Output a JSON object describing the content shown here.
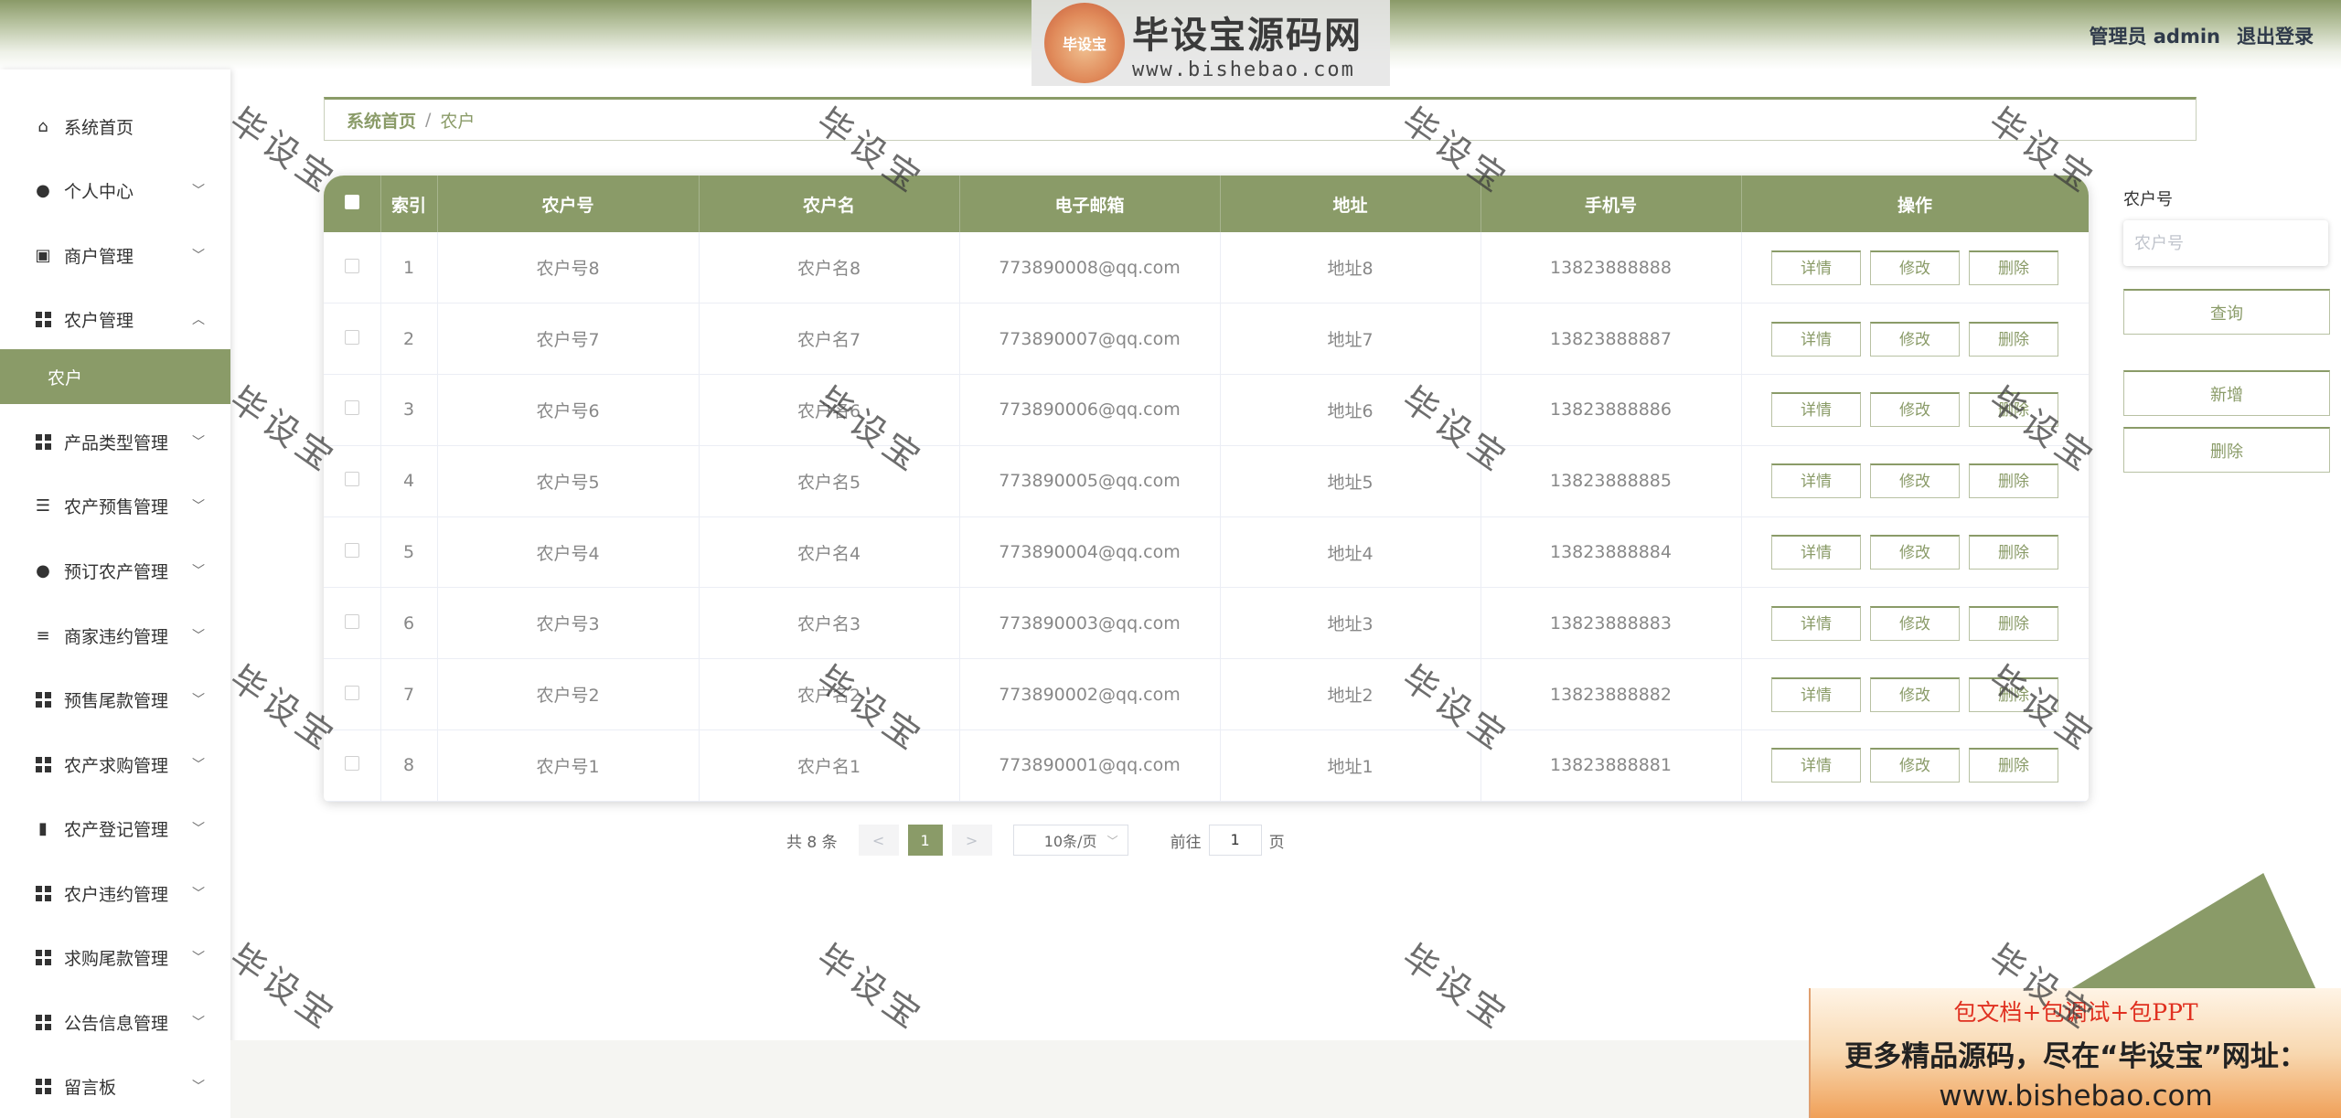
{
  "header": {
    "user_label": "管理员 admin",
    "logout_label": "退出登录"
  },
  "logo": {
    "badge": "毕设宝",
    "title": "毕设宝源码网",
    "url": "www.bishebao.com"
  },
  "sidebar": {
    "items": [
      {
        "label": "系统首页",
        "icon": "home-icon"
      },
      {
        "label": "个人中心",
        "icon": "user-icon"
      },
      {
        "label": "商户管理",
        "icon": "clipboard-check-icon"
      },
      {
        "label": "农户管理",
        "icon": "grid-icon"
      },
      {
        "label": "农户",
        "icon": ""
      },
      {
        "label": "产品类型管理",
        "icon": "grid-icon"
      },
      {
        "label": "农产预售管理",
        "icon": "sliders-icon"
      },
      {
        "label": "预订农产管理",
        "icon": "leaf-icon"
      },
      {
        "label": "商家违约管理",
        "icon": "list-icon"
      },
      {
        "label": "预售尾款管理",
        "icon": "grid-icon"
      },
      {
        "label": "农产求购管理",
        "icon": "grid-icon"
      },
      {
        "label": "农产登记管理",
        "icon": "bar-chart-icon"
      },
      {
        "label": "农户违约管理",
        "icon": "grid-icon"
      },
      {
        "label": "求购尾款管理",
        "icon": "grid-icon"
      },
      {
        "label": "公告信息管理",
        "icon": "grid-icon"
      },
      {
        "label": "留言板",
        "icon": "grid-icon"
      }
    ]
  },
  "breadcrumb": {
    "home": "系统首页",
    "separator": "/",
    "current": "农户"
  },
  "table": {
    "headers": [
      "索引",
      "农户号",
      "农户名",
      "电子邮箱",
      "地址",
      "手机号",
      "操作"
    ],
    "rows": [
      {
        "index": "1",
        "no": "农户号8",
        "name": "农户名8",
        "email": "773890008@qq.com",
        "address": "地址8",
        "phone": "13823888888"
      },
      {
        "index": "2",
        "no": "农户号7",
        "name": "农户名7",
        "email": "773890007@qq.com",
        "address": "地址7",
        "phone": "13823888887"
      },
      {
        "index": "3",
        "no": "农户号6",
        "name": "农户名6",
        "email": "773890006@qq.com",
        "address": "地址6",
        "phone": "13823888886"
      },
      {
        "index": "4",
        "no": "农户号5",
        "name": "农户名5",
        "email": "773890005@qq.com",
        "address": "地址5",
        "phone": "13823888885"
      },
      {
        "index": "5",
        "no": "农户号4",
        "name": "农户名4",
        "email": "773890004@qq.com",
        "address": "地址4",
        "phone": "13823888884"
      },
      {
        "index": "6",
        "no": "农户号3",
        "name": "农户名3",
        "email": "773890003@qq.com",
        "address": "地址3",
        "phone": "13823888883"
      },
      {
        "index": "7",
        "no": "农户号2",
        "name": "农户名2",
        "email": "773890002@qq.com",
        "address": "地址2",
        "phone": "13823888882"
      },
      {
        "index": "8",
        "no": "农户号1",
        "name": "农户名1",
        "email": "773890001@qq.com",
        "address": "地址1",
        "phone": "13823888881"
      }
    ],
    "actions": {
      "detail": "详情",
      "edit": "修改",
      "delete": "删除"
    }
  },
  "pagination": {
    "total": "共 8 条",
    "prev": "<",
    "current_page": "1",
    "next": ">",
    "page_size": "10条/页",
    "goto_prefix": "前往",
    "goto_value": "1",
    "goto_suffix": "页"
  },
  "search": {
    "label": "农户号",
    "placeholder": "农户号",
    "query_button": "查询",
    "add_button": "新增",
    "delete_button": "删除"
  },
  "watermark": "毕设宝",
  "ad": {
    "line1": "包文档+包调试+包PPT",
    "line2": "更多精品源码，尽在“毕设宝”网址：",
    "line3": "www.bishebao.com"
  },
  "colors": {
    "accent": "#8a9b68",
    "header_gradient_top": "#8a9a68",
    "ad_red": "#e03020"
  }
}
